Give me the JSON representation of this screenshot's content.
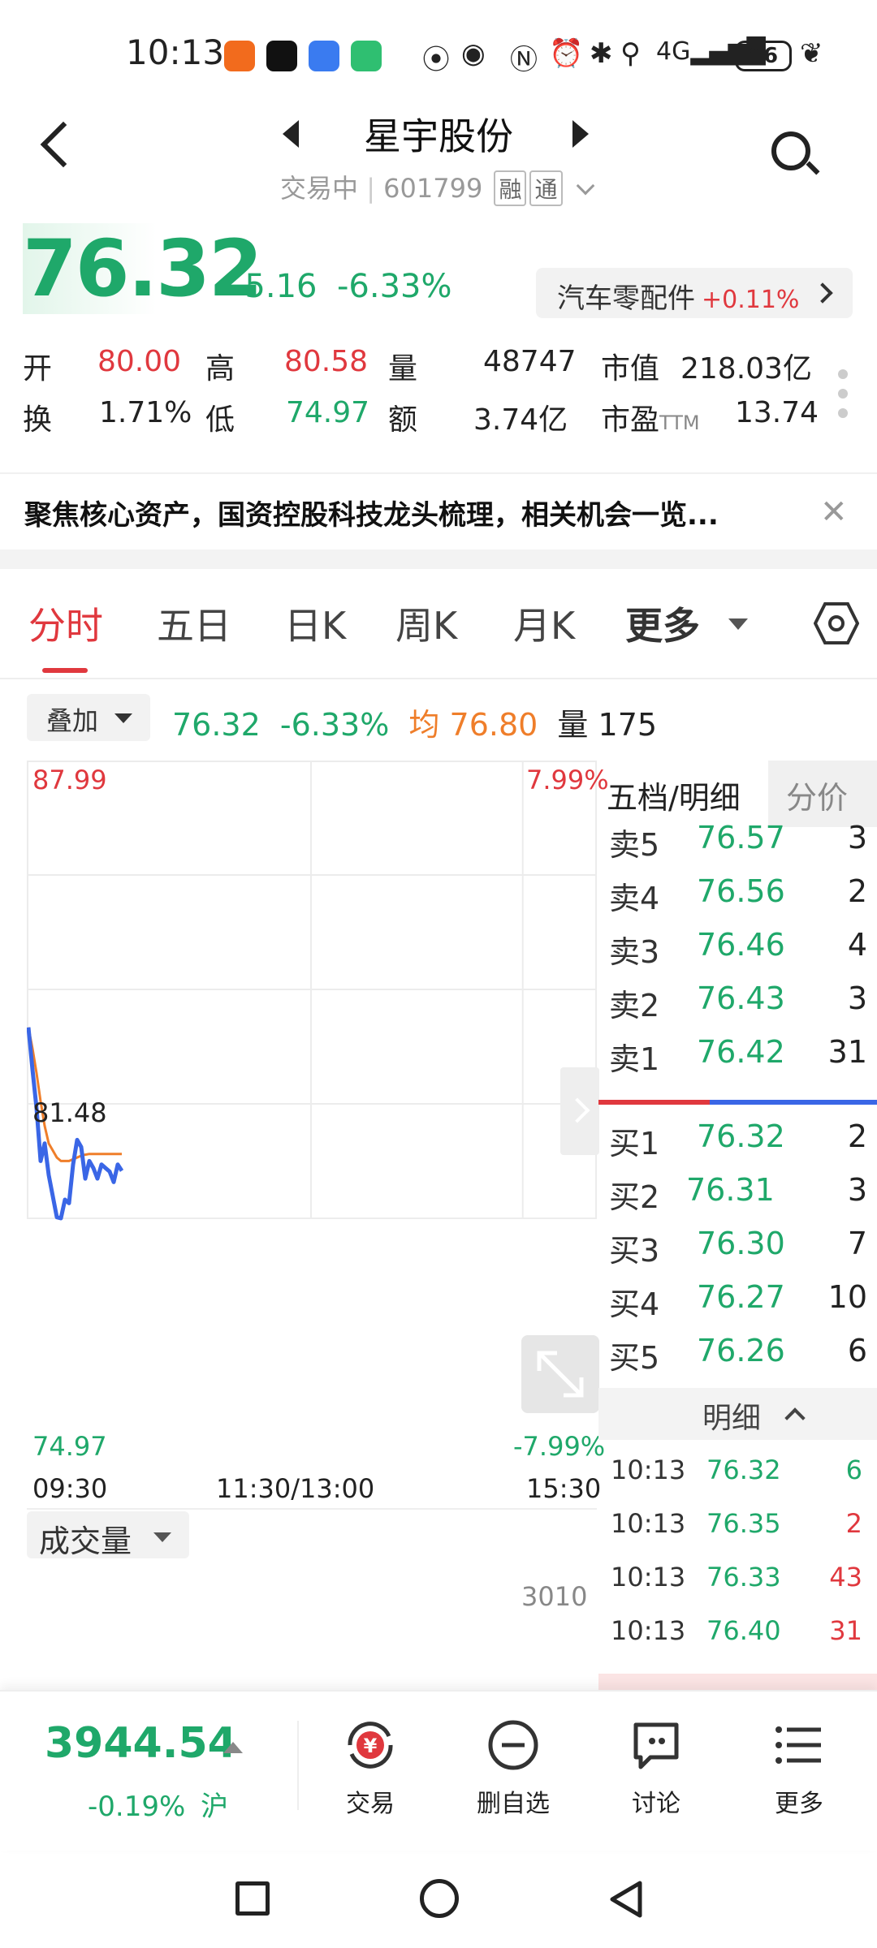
{
  "status_bar": {
    "time": "10:13",
    "battery": "86",
    "icons": [
      "app-icon-orange",
      "tiktok-icon",
      "app-icon-blue",
      "app-icon-green",
      "hd-icon",
      "eye-icon",
      "nfc-icon",
      "alarm-icon",
      "bluetooth-icon",
      "location-icon",
      "signal-4g-icon",
      "leaf-icon"
    ]
  },
  "header": {
    "title": "星宇股份",
    "status": "交易中",
    "code": "601799",
    "tags": [
      "融",
      "通"
    ]
  },
  "quote": {
    "price": "76.32",
    "change": "-5.16",
    "change_pct": "-6.33%",
    "sector_name": "汽车零配件",
    "sector_pct": "+0.11%",
    "stats": {
      "open_label": "开",
      "open": "80.00",
      "high_label": "高",
      "high": "80.58",
      "vol_label": "量",
      "vol": "48747",
      "mcap_label": "市值",
      "mcap": "218.03亿",
      "turn_label": "换",
      "turn": "1.71%",
      "low_label": "低",
      "low": "74.97",
      "amt_label": "额",
      "amt": "3.74亿",
      "pe_label": "市盈",
      "pe_sub": "TTM",
      "pe": "13.74"
    }
  },
  "news": {
    "text": "聚焦核心资产，国资控股科技龙头梳理，相关机会一览..."
  },
  "tabs": [
    "分时",
    "五日",
    "日K",
    "周K",
    "月K",
    "更多"
  ],
  "chart_bar": {
    "overlay_label": "叠加",
    "price": "76.32",
    "pct": "-6.33%",
    "avg_label": "均",
    "avg": "76.80",
    "vol_label": "量",
    "vol": "175"
  },
  "chart_data": {
    "type": "line",
    "ylim": [
      74.97,
      87.99
    ],
    "y_labels": {
      "max": "87.99",
      "mid": "81.48",
      "min": "74.97"
    },
    "pct_labels": {
      "max": "7.99%",
      "min": "-7.99%"
    },
    "x_ticks": [
      "09:30",
      "11:30/13:00",
      "15:30"
    ],
    "series": [
      {
        "name": "",
        "color": "#3a66e6",
        "values": [
          80.4,
          79.2,
          78.1,
          76.6,
          77.1,
          76.2,
          75.6,
          75.0,
          74.97,
          75.5,
          75.4,
          76.5,
          77.2,
          77.0,
          76.1,
          76.6,
          76.4,
          76.1,
          76.5,
          76.4,
          76.3,
          76.0,
          76.5,
          76.32
        ]
      },
      {
        "name": "",
        "color": "#ef7e2a",
        "values": [
          80.4,
          79.8,
          79.1,
          78.3,
          77.6,
          77.1,
          76.9,
          76.7,
          76.6,
          76.6,
          76.6,
          76.65,
          76.7,
          76.75,
          76.78,
          76.8,
          76.8,
          76.8,
          76.8,
          76.8,
          76.8,
          76.8,
          76.8,
          76.8
        ]
      }
    ],
    "volume_max_label": "3010",
    "volume_label": "成交量"
  },
  "order_book": {
    "tab_active": "五档/明细",
    "tab_inactive": "分价",
    "asks": [
      {
        "label": "卖5",
        "price": "76.57",
        "qty": "3"
      },
      {
        "label": "卖4",
        "price": "76.56",
        "qty": "2"
      },
      {
        "label": "卖3",
        "price": "76.46",
        "qty": "4"
      },
      {
        "label": "卖2",
        "price": "76.43",
        "qty": "3"
      },
      {
        "label": "卖1",
        "price": "76.42",
        "qty": "31"
      }
    ],
    "bids": [
      {
        "label": "买1",
        "price": "76.32",
        "qty": "2"
      },
      {
        "label": "买2",
        "price": "76.31",
        "qty": "3"
      },
      {
        "label": "买3",
        "price": "76.30",
        "qty": "7"
      },
      {
        "label": "买4",
        "price": "76.27",
        "qty": "10"
      },
      {
        "label": "买5",
        "price": "76.26",
        "qty": "6"
      }
    ],
    "detail_label": "明细",
    "details": [
      {
        "time": "10:13",
        "price": "76.32",
        "vol": "6",
        "dir": "g"
      },
      {
        "time": "10:13",
        "price": "76.35",
        "vol": "2",
        "dir": "r"
      },
      {
        "time": "10:13",
        "price": "76.33",
        "vol": "43",
        "dir": "r"
      },
      {
        "time": "10:13",
        "price": "76.40",
        "vol": "31",
        "dir": "r"
      }
    ]
  },
  "bottom": {
    "index_value": "3944.54",
    "index_change": "-0.19%",
    "index_market": "沪",
    "nav": [
      "交易",
      "删自选",
      "讨论",
      "更多"
    ]
  },
  "colors": {
    "up": "#e0383e",
    "down": "#1fa86a",
    "avg": "#ef7e2a",
    "price_line": "#3a66e6"
  }
}
